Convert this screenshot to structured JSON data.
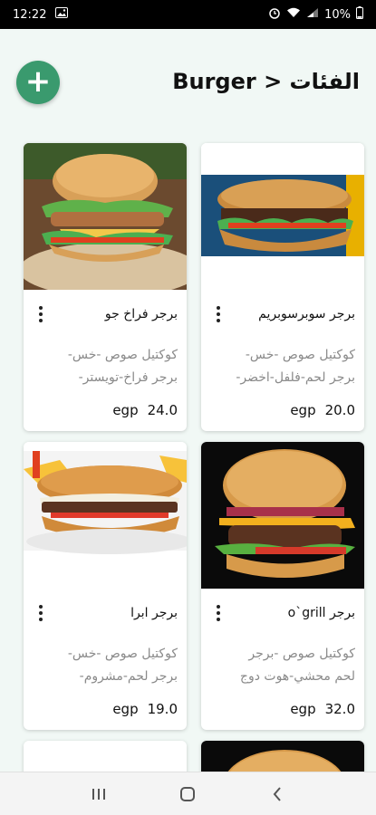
{
  "status_bar": {
    "time": "12:22",
    "battery": "10%"
  },
  "header": {
    "title": "الفئات < Burger",
    "add_label": "+"
  },
  "products": [
    {
      "name": "برجر سوبرسوبريم",
      "desc_line1": "كوكتيل صوص -خس-",
      "desc_line2": "برجر لحم-فلفل-اخضر-",
      "price": "20.0",
      "currency": "egp"
    },
    {
      "name": "برجر فراخ جو",
      "desc_line1": "كوكتيل صوص -خس-",
      "desc_line2": "برجر فراخ-تويستر-",
      "price": "24.0",
      "currency": "egp"
    },
    {
      "name": "برجر o`grill",
      "desc_line1": "كوكتيل صوص  -برجر",
      "desc_line2": "لحم محشي-هوت دوج",
      "price": "32.0",
      "currency": "egp"
    },
    {
      "name": "برجر ابرا",
      "desc_line1": "كوكتيل صوص -خس-",
      "desc_line2": "برجر لحم-مشروم-",
      "price": "19.0",
      "currency": "egp"
    }
  ],
  "colors": {
    "accent": "#3a9a6e",
    "background": "#f1f8f5"
  },
  "icons": {
    "add": "plus-icon",
    "menu": "kebab-menu-icon",
    "recents": "recents-icon",
    "home": "home-icon",
    "back": "back-icon"
  }
}
